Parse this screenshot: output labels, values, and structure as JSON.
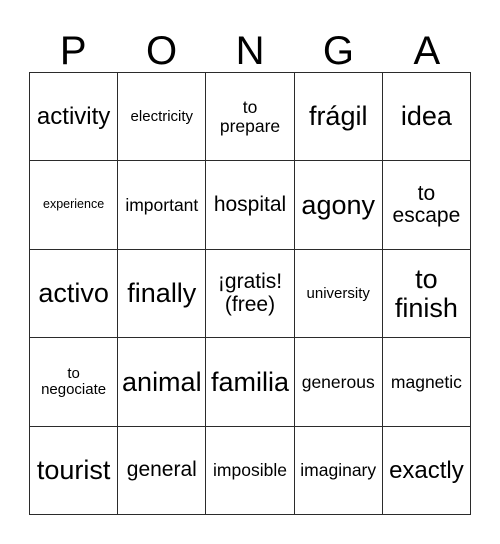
{
  "card": {
    "header_letters": [
      "P",
      "O",
      "N",
      "G",
      "A"
    ],
    "rows": [
      [
        {
          "text": "activity",
          "size": "fs-xl"
        },
        {
          "text": "electricity",
          "size": "fs-s"
        },
        {
          "text": "to\nprepare",
          "size": "fs-m"
        },
        {
          "text": "frágil",
          "size": "fs-xxl"
        },
        {
          "text": "idea",
          "size": "fs-xxl"
        }
      ],
      [
        {
          "text": "experience",
          "size": "fs-xs"
        },
        {
          "text": "important",
          "size": "fs-m"
        },
        {
          "text": "hospital",
          "size": "fs-l"
        },
        {
          "text": "agony",
          "size": "fs-xxl"
        },
        {
          "text": "to\nescape",
          "size": "fs-l"
        }
      ],
      [
        {
          "text": "activo",
          "size": "fs-xxl"
        },
        {
          "text": "finally",
          "size": "fs-xxl"
        },
        {
          "text": "¡gratis!\n(free)",
          "size": "fs-l"
        },
        {
          "text": "university",
          "size": "fs-s"
        },
        {
          "text": "to\nfinish",
          "size": "fs-xxl"
        }
      ],
      [
        {
          "text": "to\nnegociate",
          "size": "fs-s"
        },
        {
          "text": "animal",
          "size": "fs-xxl"
        },
        {
          "text": "familia",
          "size": "fs-xxl"
        },
        {
          "text": "generous",
          "size": "fs-m"
        },
        {
          "text": "magnetic",
          "size": "fs-m"
        }
      ],
      [
        {
          "text": "tourist",
          "size": "fs-xxl"
        },
        {
          "text": "general",
          "size": "fs-l"
        },
        {
          "text": "imposible",
          "size": "fs-m"
        },
        {
          "text": "imaginary",
          "size": "fs-m"
        },
        {
          "text": "exactly",
          "size": "fs-xl"
        }
      ]
    ]
  },
  "colors": {
    "grid_line": "#2b2b2b",
    "text": "#000000",
    "background": "#ffffff"
  }
}
